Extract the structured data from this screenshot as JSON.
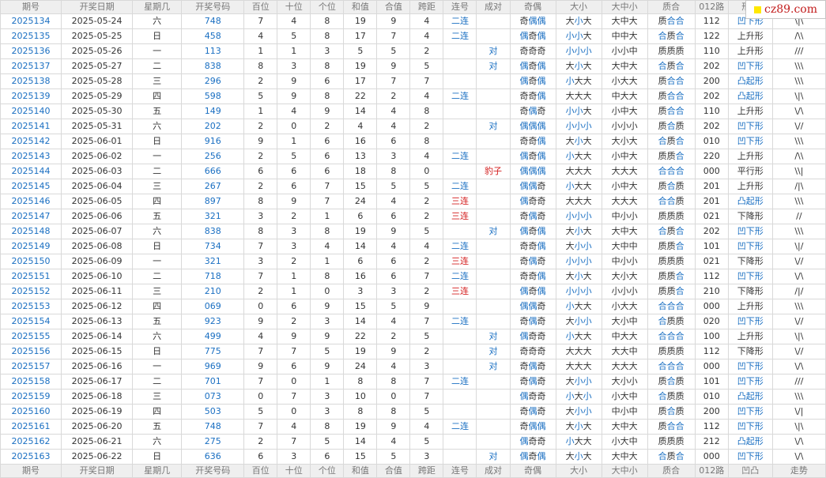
{
  "headers": [
    "期号",
    "开奖日期",
    "星期几",
    "开奖号码",
    "百位",
    "十位",
    "个位",
    "和值",
    "合值",
    "跨距",
    "连号",
    "成对",
    "奇偶",
    "大小",
    "大中小",
    "质合",
    "012路",
    "形态",
    "走势"
  ],
  "footer_headers": [
    "期号",
    "开奖日期",
    "星期几",
    "开奖号码",
    "百位",
    "十位",
    "个位",
    "和值",
    "合值",
    "跨距",
    "连号",
    "成对",
    "奇偶",
    "大小",
    "大中小",
    "质合",
    "012路",
    "凹凸",
    "走势"
  ],
  "watermark": "cz89.com",
  "rows": [
    {
      "qi": "2025134",
      "date": "2025-05-24",
      "week": "六",
      "num": "748",
      "bai": "7",
      "shi": "4",
      "ge": "8",
      "sum": "19",
      "he": "9",
      "span": "4",
      "lian": "二连",
      "dui": "",
      "jo": "奇偶偶",
      "dx": "大小大",
      "dzx": "大中大",
      "zh": "质合合",
      "r012": "112",
      "shape": "凹下形",
      "trend": "\\|\\"
    },
    {
      "qi": "2025135",
      "date": "2025-05-25",
      "week": "日",
      "num": "458",
      "bai": "4",
      "shi": "5",
      "ge": "8",
      "sum": "17",
      "he": "7",
      "span": "4",
      "lian": "二连",
      "dui": "",
      "jo": "偶奇偶",
      "dx": "小小大",
      "dzx": "中中大",
      "zh": "合质合",
      "r012": "122",
      "shape": "上升形",
      "trend": "/\\\\"
    },
    {
      "qi": "2025136",
      "date": "2025-05-26",
      "week": "一",
      "num": "113",
      "bai": "1",
      "shi": "1",
      "ge": "3",
      "sum": "5",
      "he": "5",
      "span": "2",
      "lian": "",
      "dui": "对",
      "jo": "奇奇奇",
      "dx": "小小小",
      "dzx": "小小中",
      "zh": "质质质",
      "r012": "110",
      "shape": "上升形",
      "trend": "///"
    },
    {
      "qi": "2025137",
      "date": "2025-05-27",
      "week": "二",
      "num": "838",
      "bai": "8",
      "shi": "3",
      "ge": "8",
      "sum": "19",
      "he": "9",
      "span": "5",
      "lian": "",
      "dui": "对",
      "jo": "偶奇偶",
      "dx": "大小大",
      "dzx": "大中大",
      "zh": "合质合",
      "r012": "202",
      "shape": "凹下形",
      "trend": "\\\\\\"
    },
    {
      "qi": "2025138",
      "date": "2025-05-28",
      "week": "三",
      "num": "296",
      "bai": "2",
      "shi": "9",
      "ge": "6",
      "sum": "17",
      "he": "7",
      "span": "7",
      "lian": "",
      "dui": "",
      "jo": "偶奇偶",
      "dx": "小大大",
      "dzx": "小大大",
      "zh": "质合合",
      "r012": "200",
      "shape": "凸起形",
      "trend": "\\\\\\"
    },
    {
      "qi": "2025139",
      "date": "2025-05-29",
      "week": "四",
      "num": "598",
      "bai": "5",
      "shi": "9",
      "ge": "8",
      "sum": "22",
      "he": "2",
      "span": "4",
      "lian": "二连",
      "dui": "",
      "jo": "奇奇偶",
      "dx": "大大大",
      "dzx": "中大大",
      "zh": "质合合",
      "r012": "202",
      "shape": "凸起形",
      "trend": "\\|\\"
    },
    {
      "qi": "2025140",
      "date": "2025-05-30",
      "week": "五",
      "num": "149",
      "bai": "1",
      "shi": "4",
      "ge": "9",
      "sum": "14",
      "he": "4",
      "span": "8",
      "lian": "",
      "dui": "",
      "jo": "奇偶奇",
      "dx": "小小大",
      "dzx": "小中大",
      "zh": "质合合",
      "r012": "110",
      "shape": "上升形",
      "trend": "\\/\\"
    },
    {
      "qi": "2025141",
      "date": "2025-05-31",
      "week": "六",
      "num": "202",
      "bai": "2",
      "shi": "0",
      "ge": "2",
      "sum": "4",
      "he": "4",
      "span": "2",
      "lian": "",
      "dui": "对",
      "jo": "偶偶偶",
      "dx": "小小小",
      "dzx": "小小小",
      "zh": "质合质",
      "r012": "202",
      "shape": "凹下形",
      "trend": "\\//"
    },
    {
      "qi": "2025142",
      "date": "2025-06-01",
      "week": "日",
      "num": "916",
      "bai": "9",
      "shi": "1",
      "ge": "6",
      "sum": "16",
      "he": "6",
      "span": "8",
      "lian": "",
      "dui": "",
      "jo": "奇奇偶",
      "dx": "大小大",
      "dzx": "大小大",
      "zh": "合质合",
      "r012": "010",
      "shape": "凹下形",
      "trend": "\\\\\\"
    },
    {
      "qi": "2025143",
      "date": "2025-06-02",
      "week": "一",
      "num": "256",
      "bai": "2",
      "shi": "5",
      "ge": "6",
      "sum": "13",
      "he": "3",
      "span": "4",
      "lian": "二连",
      "dui": "",
      "jo": "偶奇偶",
      "dx": "小大大",
      "dzx": "小中大",
      "zh": "质质合",
      "r012": "220",
      "shape": "上升形",
      "trend": "/\\\\"
    },
    {
      "qi": "2025144",
      "date": "2025-06-03",
      "week": "二",
      "num": "666",
      "bai": "6",
      "shi": "6",
      "ge": "6",
      "sum": "18",
      "he": "8",
      "span": "0",
      "lian": "",
      "dui": "豹子",
      "jo": "偶偶偶",
      "dx": "大大大",
      "dzx": "大大大",
      "zh": "合合合",
      "r012": "000",
      "shape": "平行形",
      "trend": "\\\\|"
    },
    {
      "qi": "2025145",
      "date": "2025-06-04",
      "week": "三",
      "num": "267",
      "bai": "2",
      "shi": "6",
      "ge": "7",
      "sum": "15",
      "he": "5",
      "span": "5",
      "lian": "二连",
      "dui": "",
      "jo": "偶偶奇",
      "dx": "小大大",
      "dzx": "小中大",
      "zh": "质合质",
      "r012": "201",
      "shape": "上升形",
      "trend": "/|\\"
    },
    {
      "qi": "2025146",
      "date": "2025-06-05",
      "week": "四",
      "num": "897",
      "bai": "8",
      "shi": "9",
      "ge": "7",
      "sum": "24",
      "he": "4",
      "span": "2",
      "lian": "三连",
      "dui": "",
      "jo": "偶奇奇",
      "dx": "大大大",
      "dzx": "大大大",
      "zh": "合合质",
      "r012": "201",
      "shape": "凸起形",
      "trend": "\\\\\\"
    },
    {
      "qi": "2025147",
      "date": "2025-06-06",
      "week": "五",
      "num": "321",
      "bai": "3",
      "shi": "2",
      "ge": "1",
      "sum": "6",
      "he": "6",
      "span": "2",
      "lian": "三连",
      "dui": "",
      "jo": "奇偶奇",
      "dx": "小小小",
      "dzx": "中小小",
      "zh": "质质质",
      "r012": "021",
      "shape": "下降形",
      "trend": "//"
    },
    {
      "qi": "2025148",
      "date": "2025-06-07",
      "week": "六",
      "num": "838",
      "bai": "8",
      "shi": "3",
      "ge": "8",
      "sum": "19",
      "he": "9",
      "span": "5",
      "lian": "",
      "dui": "对",
      "jo": "偶奇偶",
      "dx": "大小大",
      "dzx": "大中大",
      "zh": "合质合",
      "r012": "202",
      "shape": "凹下形",
      "trend": "\\\\\\"
    },
    {
      "qi": "2025149",
      "date": "2025-06-08",
      "week": "日",
      "num": "734",
      "bai": "7",
      "shi": "3",
      "ge": "4",
      "sum": "14",
      "he": "4",
      "span": "4",
      "lian": "二连",
      "dui": "",
      "jo": "奇奇偶",
      "dx": "大小小",
      "dzx": "大中中",
      "zh": "质质合",
      "r012": "101",
      "shape": "凹下形",
      "trend": "\\|/"
    },
    {
      "qi": "2025150",
      "date": "2025-06-09",
      "week": "一",
      "num": "321",
      "bai": "3",
      "shi": "2",
      "ge": "1",
      "sum": "6",
      "he": "6",
      "span": "2",
      "lian": "三连",
      "dui": "",
      "jo": "奇偶奇",
      "dx": "小小小",
      "dzx": "中小小",
      "zh": "质质质",
      "r012": "021",
      "shape": "下降形",
      "trend": "\\//"
    },
    {
      "qi": "2025151",
      "date": "2025-06-10",
      "week": "二",
      "num": "718",
      "bai": "7",
      "shi": "1",
      "ge": "8",
      "sum": "16",
      "he": "6",
      "span": "7",
      "lian": "二连",
      "dui": "",
      "jo": "奇奇偶",
      "dx": "大小大",
      "dzx": "大小大",
      "zh": "质质合",
      "r012": "112",
      "shape": "凹下形",
      "trend": "\\/\\"
    },
    {
      "qi": "2025152",
      "date": "2025-06-11",
      "week": "三",
      "num": "210",
      "bai": "2",
      "shi": "1",
      "ge": "0",
      "sum": "3",
      "he": "3",
      "span": "2",
      "lian": "三连",
      "dui": "",
      "jo": "偶奇偶",
      "dx": "小小小",
      "dzx": "小小小",
      "zh": "质质合",
      "r012": "210",
      "shape": "下降形",
      "trend": "/|/"
    },
    {
      "qi": "2025153",
      "date": "2025-06-12",
      "week": "四",
      "num": "069",
      "bai": "0",
      "shi": "6",
      "ge": "9",
      "sum": "15",
      "he": "5",
      "span": "9",
      "lian": "",
      "dui": "",
      "jo": "偶偶奇",
      "dx": "小大大",
      "dzx": "小大大",
      "zh": "合合合",
      "r012": "000",
      "shape": "上升形",
      "trend": "\\\\\\"
    },
    {
      "qi": "2025154",
      "date": "2025-06-13",
      "week": "五",
      "num": "923",
      "bai": "9",
      "shi": "2",
      "ge": "3",
      "sum": "14",
      "he": "4",
      "span": "7",
      "lian": "二连",
      "dui": "",
      "jo": "奇偶奇",
      "dx": "大小小",
      "dzx": "大小中",
      "zh": "合质质",
      "r012": "020",
      "shape": "凹下形",
      "trend": "\\//"
    },
    {
      "qi": "2025155",
      "date": "2025-06-14",
      "week": "六",
      "num": "499",
      "bai": "4",
      "shi": "9",
      "ge": "9",
      "sum": "22",
      "he": "2",
      "span": "5",
      "lian": "",
      "dui": "对",
      "jo": "偶奇奇",
      "dx": "小大大",
      "dzx": "中大大",
      "zh": "合合合",
      "r012": "100",
      "shape": "上升形",
      "trend": "\\|\\"
    },
    {
      "qi": "2025156",
      "date": "2025-06-15",
      "week": "日",
      "num": "775",
      "bai": "7",
      "shi": "7",
      "ge": "5",
      "sum": "19",
      "he": "9",
      "span": "2",
      "lian": "",
      "dui": "对",
      "jo": "奇奇奇",
      "dx": "大大大",
      "dzx": "大大中",
      "zh": "质质质",
      "r012": "112",
      "shape": "下降形",
      "trend": "\\//"
    },
    {
      "qi": "2025157",
      "date": "2025-06-16",
      "week": "一",
      "num": "969",
      "bai": "9",
      "shi": "6",
      "ge": "9",
      "sum": "24",
      "he": "4",
      "span": "3",
      "lian": "",
      "dui": "对",
      "jo": "奇偶奇",
      "dx": "大大大",
      "dzx": "大大大",
      "zh": "合合合",
      "r012": "000",
      "shape": "凹下形",
      "trend": "\\/\\"
    },
    {
      "qi": "2025158",
      "date": "2025-06-17",
      "week": "二",
      "num": "701",
      "bai": "7",
      "shi": "0",
      "ge": "1",
      "sum": "8",
      "he": "8",
      "span": "7",
      "lian": "二连",
      "dui": "",
      "jo": "奇偶奇",
      "dx": "大小小",
      "dzx": "大小小",
      "zh": "质合质",
      "r012": "101",
      "shape": "凹下形",
      "trend": "///"
    },
    {
      "qi": "2025159",
      "date": "2025-06-18",
      "week": "三",
      "num": "073",
      "bai": "0",
      "shi": "7",
      "ge": "3",
      "sum": "10",
      "he": "0",
      "span": "7",
      "lian": "",
      "dui": "",
      "jo": "偶奇奇",
      "dx": "小大小",
      "dzx": "小大中",
      "zh": "合质质",
      "r012": "010",
      "shape": "凸起形",
      "trend": "\\\\\\"
    },
    {
      "qi": "2025160",
      "date": "2025-06-19",
      "week": "四",
      "num": "503",
      "bai": "5",
      "shi": "0",
      "ge": "3",
      "sum": "8",
      "he": "8",
      "span": "5",
      "lian": "",
      "dui": "",
      "jo": "奇偶奇",
      "dx": "大小小",
      "dzx": "中小中",
      "zh": "质合质",
      "r012": "200",
      "shape": "凹下形",
      "trend": "\\/|"
    },
    {
      "qi": "2025161",
      "date": "2025-06-20",
      "week": "五",
      "num": "748",
      "bai": "7",
      "shi": "4",
      "ge": "8",
      "sum": "19",
      "he": "9",
      "span": "4",
      "lian": "二连",
      "dui": "",
      "jo": "奇偶偶",
      "dx": "大小大",
      "dzx": "大中大",
      "zh": "质合合",
      "r012": "112",
      "shape": "凹下形",
      "trend": "\\|\\"
    },
    {
      "qi": "2025162",
      "date": "2025-06-21",
      "week": "六",
      "num": "275",
      "bai": "2",
      "shi": "7",
      "ge": "5",
      "sum": "14",
      "he": "4",
      "span": "5",
      "lian": "",
      "dui": "",
      "jo": "偶奇奇",
      "dx": "小大大",
      "dzx": "小大中",
      "zh": "质质质",
      "r012": "212",
      "shape": "凸起形",
      "trend": "\\/\\"
    },
    {
      "qi": "2025163",
      "date": "2025-06-22",
      "week": "日",
      "num": "636",
      "bai": "6",
      "shi": "3",
      "ge": "6",
      "sum": "15",
      "he": "5",
      "span": "3",
      "lian": "",
      "dui": "对",
      "jo": "偶奇偶",
      "dx": "大小大",
      "dzx": "大中大",
      "zh": "合质合",
      "r012": "000",
      "shape": "凹下形",
      "trend": "\\/\\"
    }
  ]
}
